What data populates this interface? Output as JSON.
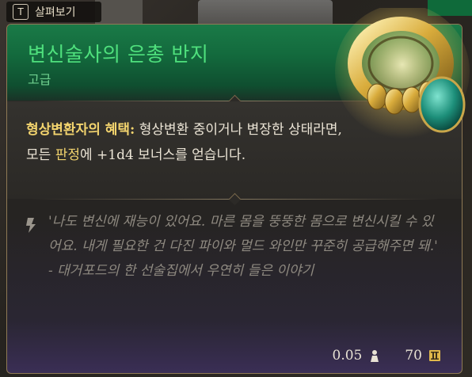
{
  "hint": {
    "key": "T",
    "label": "살펴보기"
  },
  "item": {
    "name": "변신술사의 은총 반지",
    "rarity": "고급",
    "rarity_color": "#4fe07d"
  },
  "effect": {
    "name": "형상변환자의 혜택:",
    "text_before": " 형상변환 중이거나 변장한 상태라면, 모든 ",
    "highlight": "판정",
    "text_after": "에 +1d4 보너스를 얻습니다."
  },
  "flavor": {
    "text": "'나도 변신에 재능이 있어요. 마른 몸을 뚱뚱한 몸으로 변신시킬 수 있어요. 내게 필요한 건 다진 파이와 멀드 와인만 꾸준히 공급해주면 돼.' - 대거포드의 한 선술집에서 우연히 들은 이야기"
  },
  "footer": {
    "weight": "0.05",
    "value": "70",
    "weight_icon": "weight-icon",
    "value_icon": "gold-coin-icon"
  },
  "colors": {
    "accent": "#f3d46e",
    "header_green": "#136a3d",
    "border": "#8f7a55"
  }
}
